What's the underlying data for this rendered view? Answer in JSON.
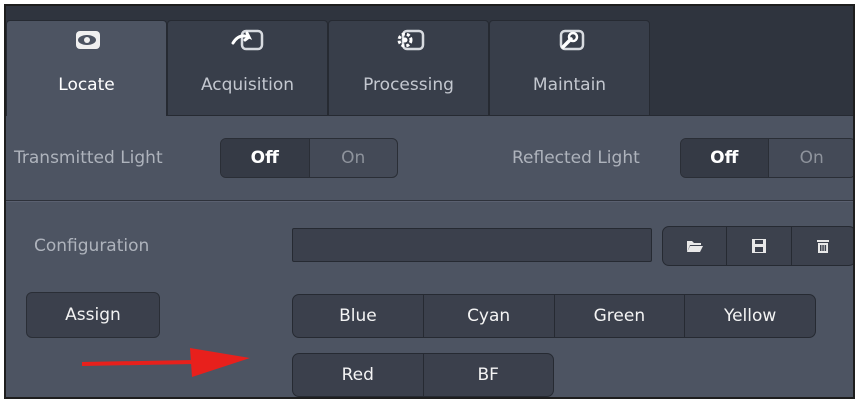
{
  "tabs": [
    {
      "label": "Locate",
      "icon": "eye-icon",
      "active": true
    },
    {
      "label": "Acquisition",
      "icon": "acquisition-arrow-icon",
      "active": false
    },
    {
      "label": "Processing",
      "icon": "gear-icon",
      "active": false
    },
    {
      "label": "Maintain",
      "icon": "wrench-icon",
      "active": false
    }
  ],
  "transmitted_light": {
    "label": "Transmitted Light",
    "options": [
      "Off",
      "On"
    ],
    "selected": "Off"
  },
  "reflected_light": {
    "label": "Reflected Light",
    "options": [
      "Off",
      "On"
    ],
    "selected": "Off"
  },
  "configuration": {
    "label": "Configuration",
    "value": "",
    "placeholder": "",
    "icons": [
      "folder-open-icon",
      "save-icon",
      "delete-icon"
    ]
  },
  "assign": {
    "label": "Assign"
  },
  "channels": {
    "row1": [
      "Blue",
      "Cyan",
      "Green",
      "Yellow"
    ],
    "row2": [
      "Red",
      "BF"
    ]
  },
  "colors": {
    "annotation_arrow": "#e8201c"
  }
}
